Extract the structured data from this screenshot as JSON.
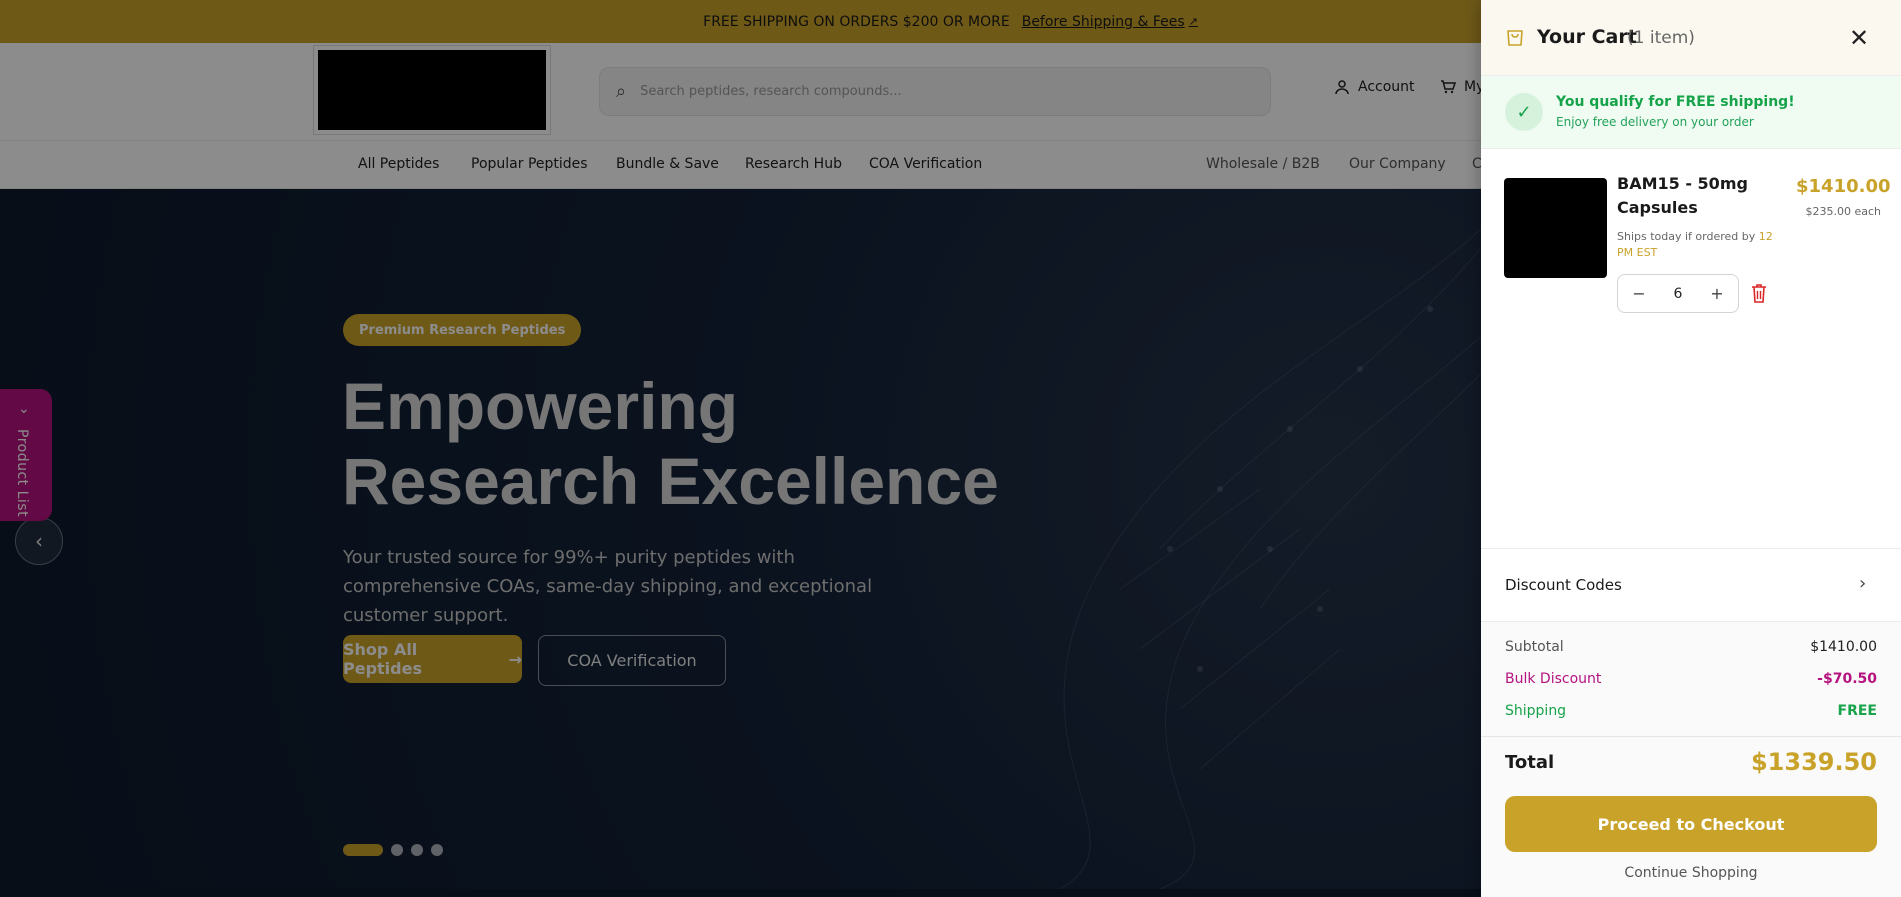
{
  "announcement": {
    "text": "FREE SHIPPING ON ORDERS $200 OR MORE",
    "link": "Before Shipping & Fees"
  },
  "header": {
    "search_placeholder": "Search peptides, research compounds...",
    "account_label": "Account",
    "cart_label": "My"
  },
  "nav": {
    "items": [
      "All Peptides",
      "Popular Peptides",
      "Bundle & Save",
      "Research Hub",
      "COA Verification"
    ],
    "secondary": [
      "Wholesale / B2B",
      "Our Company",
      "C"
    ]
  },
  "hero": {
    "badge": "Premium Research Peptides",
    "title_line1": "Empowering",
    "title_line2": "Research Excellence",
    "subtitle": "Your trusted source for 99%+ purity peptides with comprehensive COAs, same-day shipping, and exceptional customer support.",
    "primary_button": "Shop All Peptides",
    "secondary_button": "COA Verification"
  },
  "product_tab": {
    "label": "Product List"
  },
  "cart": {
    "title": "Your Cart",
    "count": "(1 item)",
    "shipping_title": "You qualify for FREE shipping!",
    "shipping_sub": "Enjoy free delivery on your order",
    "item": {
      "name": "BAM15 - 50mg Capsules",
      "ships_prefix": "Ships today if ordered by ",
      "ships_time": "12 PM EST",
      "price": "$1410.00",
      "each": "$235.00 each",
      "quantity": "6"
    },
    "discount_label": "Discount Codes",
    "summary": {
      "subtotal_label": "Subtotal",
      "subtotal_value": "$1410.00",
      "bulk_label": "Bulk Discount",
      "bulk_value": "-$70.50",
      "shipping_label": "Shipping",
      "shipping_value": "FREE",
      "total_label": "Total",
      "total_value": "$1339.50"
    },
    "checkout_label": "Proceed to Checkout",
    "continue_label": "Continue Shopping"
  },
  "colors": {
    "accent": "#c9a22a",
    "success": "#16a34a",
    "discount": "#b5127f",
    "hero_bg": "#0d1a2c"
  }
}
